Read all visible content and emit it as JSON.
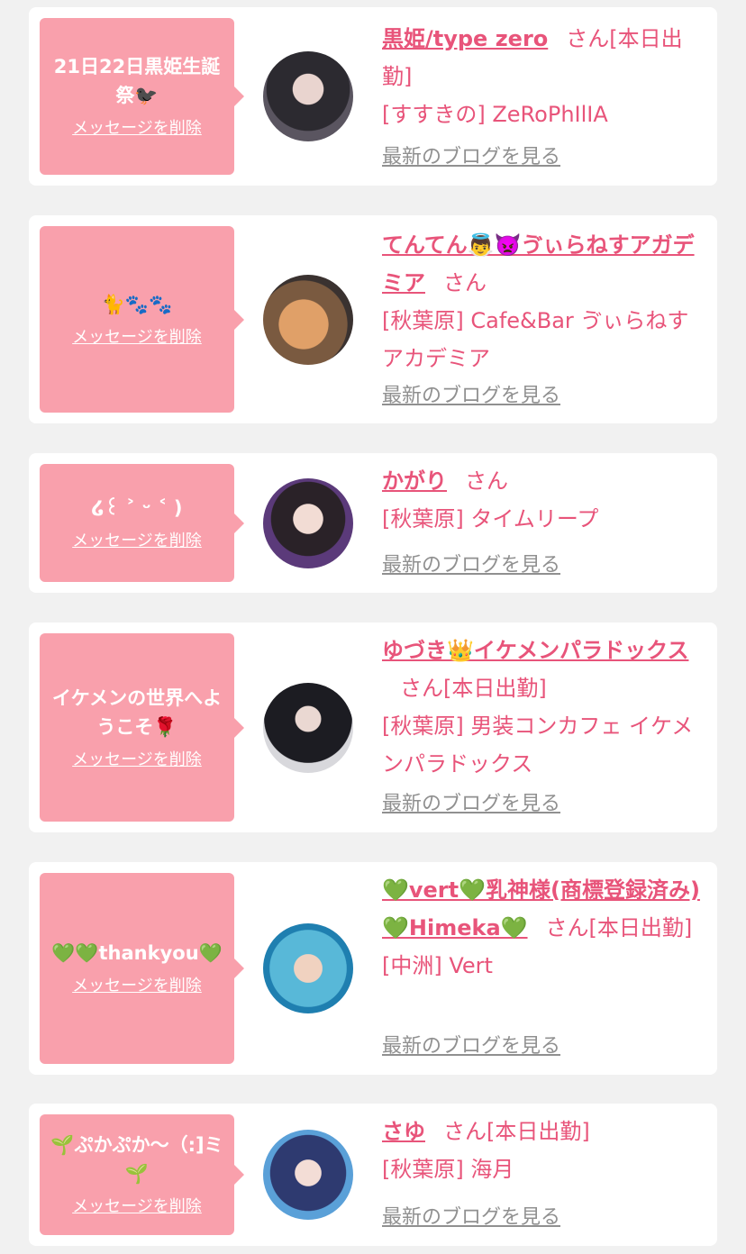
{
  "delete_label": "メッセージを削除",
  "blog_label": "最新のブログを見る",
  "san_suffix": "さん",
  "entries": [
    {
      "message": "21日22日黒姫生誕祭🐦‍⬛",
      "name": "黒姫/type zero",
      "status": "[本日出勤]",
      "shop": "[すすきの] ZeRoPhIlIA"
    },
    {
      "message": "🐈🐾🐾",
      "name": "てんてん👼👿ゔぃらねすアガデミア",
      "status": "",
      "shop": "[秋葉原] Cafe&Bar ゔぃらねすアカデミア"
    },
    {
      "message": "໒꒰ ˃ ᵕ ˂ )",
      "name": "かがり",
      "status": "",
      "shop": "[秋葉原] タイムリープ"
    },
    {
      "message": "イケメンの世界へようこそ🌹",
      "name": "ゆづき👑イケメンパラドックス",
      "status": "[本日出勤]",
      "shop": "[秋葉原] 男装コンカフェ イケメンパラドックス"
    },
    {
      "message": "💚💚thankyou💚",
      "name": "💚vert💚乳神様(商標登録済み)💚Himeka💚",
      "status": "[本日出勤]",
      "shop": "[中洲] Vert"
    },
    {
      "message": "🌱ぷかぷか〜（:]ミ🌱",
      "name": "さゆ",
      "status": "[本日出勤]",
      "shop": "[秋葉原] 海月"
    }
  ]
}
